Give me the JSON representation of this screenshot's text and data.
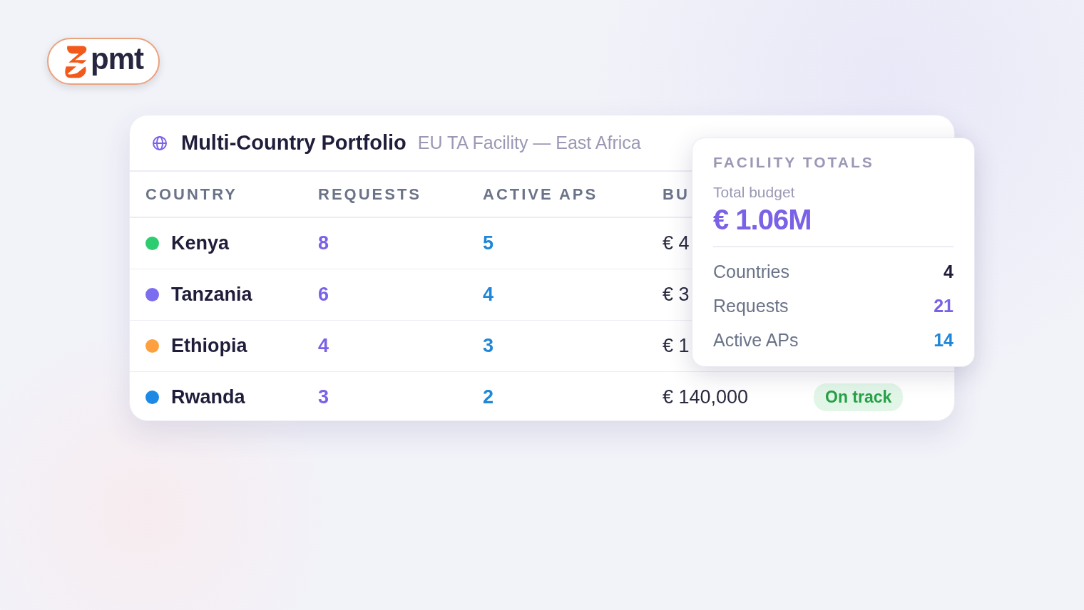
{
  "logo": {
    "text": "pmt"
  },
  "card": {
    "title": "Multi-Country Portfolio",
    "subtitle": "EU TA Facility — East Africa",
    "columns": [
      "COUNTRY",
      "REQUESTS",
      "ACTIVE APS",
      "BU"
    ],
    "rows": [
      {
        "country": "Kenya",
        "color": "#2ecc71",
        "requests": "8",
        "active_aps": "5",
        "budget": "€ 4"
      },
      {
        "country": "Tanzania",
        "color": "#7b6cf0",
        "requests": "6",
        "active_aps": "4",
        "budget": "€ 3"
      },
      {
        "country": "Ethiopia",
        "color": "#ffa040",
        "requests": "4",
        "active_aps": "3",
        "budget": "€ 1"
      },
      {
        "country": "Rwanda",
        "color": "#1e88e5",
        "requests": "3",
        "active_aps": "2",
        "budget": "€ 140,000",
        "status": {
          "label": "On track",
          "kind": "good"
        }
      }
    ]
  },
  "totals": {
    "title": "FACILITY TOTALS",
    "budget_label": "Total budget",
    "budget_value": "€ 1.06M",
    "stats": [
      {
        "label": "Countries",
        "value": "4",
        "color": "#1f1d3a"
      },
      {
        "label": "Requests",
        "value": "21",
        "color": "#7b61e8"
      },
      {
        "label": "Active APs",
        "value": "14",
        "color": "#1f86d8"
      }
    ]
  }
}
